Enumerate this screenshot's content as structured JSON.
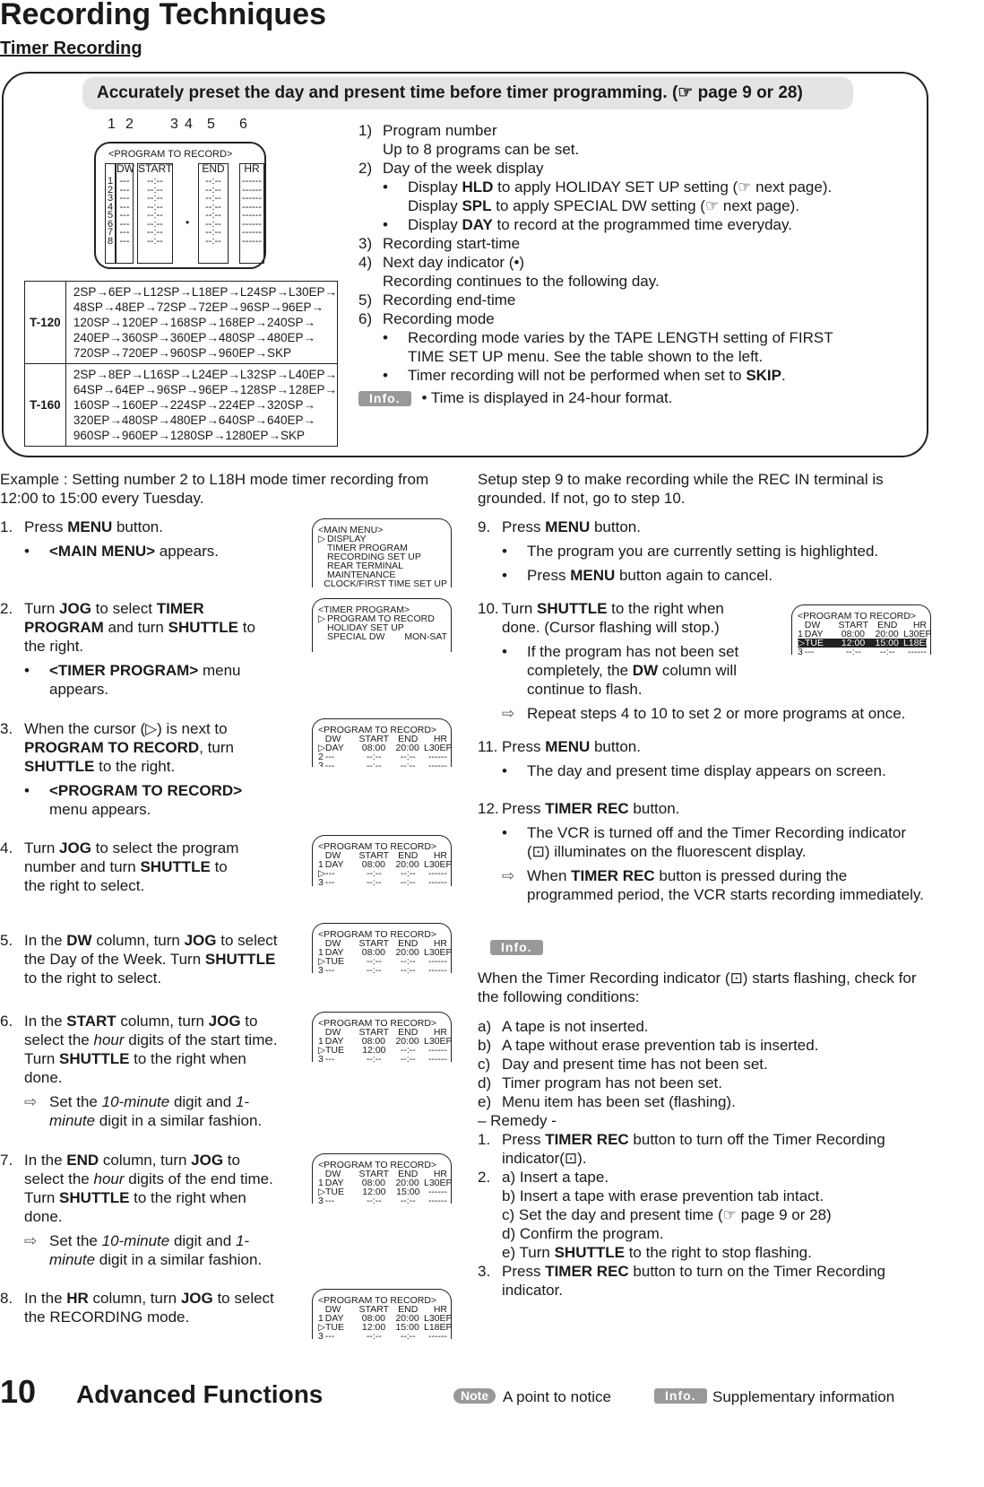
{
  "title": "Recording Techniques",
  "subtitle": "Timer Recording",
  "banner": "Accurately preset the day and present time before timer programming. (☞ page 9 or 28)",
  "diagram": {
    "callouts": [
      "1",
      "2",
      "3",
      "4",
      "5",
      "6"
    ],
    "title": "<PROGRAM TO RECORD>",
    "headers": [
      "DW",
      "START",
      "END",
      "HR"
    ],
    "numbers": [
      "1",
      "2",
      "3",
      "4",
      "5",
      "6",
      "7",
      "8"
    ],
    "dw": "---",
    "start": "--:--",
    "end": "--:--",
    "hr": "------",
    "dot": "•"
  },
  "tape_table": [
    {
      "key": "T-120",
      "lines": [
        "2SP→6EP→L12SP→L18EP→L24SP→L30EP→",
        "48SP→48EP→72SP→72EP→96SP→96EP→",
        "120SP→120EP→168SP→168EP→240SP→",
        "240EP→360SP→360EP→480SP→480EP→",
        "720SP→720EP→960SP→960EP→SKP"
      ]
    },
    {
      "key": "T-160",
      "lines": [
        "2SP→8EP→L16SP→L24EP→L32SP→L40EP→",
        "64SP→64EP→96SP→96EP→128SP→128EP→",
        "160SP→160EP→224SP→224EP→320SP→",
        "320EP→480SP→480EP→640SP→640EP→",
        "960SP→960EP→1280SP→1280EP→SKP"
      ]
    }
  ],
  "legend": [
    {
      "n": "1)",
      "t": "Program number"
    },
    {
      "n": "",
      "t": "Up to 8 programs can be set."
    },
    {
      "n": "2)",
      "t": "Day of the week display"
    },
    {
      "b": "•",
      "t": "Display **HLD** to apply HOLIDAY SET UP setting (☞ next page)."
    },
    {
      "b": "",
      "t": "Display **SPL** to apply SPECIAL DW setting (☞ next page)."
    },
    {
      "b": "•",
      "t": "Display **DAY** to record at the programmed time everyday."
    },
    {
      "n": "3)",
      "t": "Recording start-time"
    },
    {
      "n": "4)",
      "t": "Next day indicator (•)"
    },
    {
      "n": "",
      "t": "Recording continues to the following day."
    },
    {
      "n": "5)",
      "t": "Recording end-time"
    },
    {
      "n": "6)",
      "t": "Recording mode"
    },
    {
      "b": "•",
      "t": "Recording mode varies by the TAPE LENGTH setting of FIRST"
    },
    {
      "b": "",
      "t": "TIME SET UP menu.  See the table shown to the left."
    },
    {
      "b": "•",
      "t": "Timer recording will not be performed when set to **SKIP**."
    }
  ],
  "legend_info": {
    "badge": "Info.",
    "text": "•  Time is displayed in 24-hour format."
  },
  "example": "Example : Setting number 2 to L18H mode timer recording from 12:00 to 15:00 every Tuesday.",
  "left_steps": [
    {
      "n": "1.",
      "t": "Press **MENU** button.",
      "items": [
        {
          "b": "•",
          "t": "**<MAIN MENU>** appears."
        }
      ]
    },
    {
      "n": "2.",
      "t": "Turn **JOG** to select **TIMER PROGRAM** and turn **SHUTTLE** to the right.",
      "items": [
        {
          "b": "•",
          "t": "**<TIMER PROGRAM>** menu appears."
        }
      ]
    },
    {
      "n": "3.",
      "t": "When the cursor (▷) is next to **PROGRAM TO RECORD**, turn **SHUTTLE** to the right.",
      "items": [
        {
          "b": "•",
          "t": "**<PROGRAM TO RECORD>** menu appears."
        }
      ]
    },
    {
      "n": "4.",
      "t": "Turn **JOG** to select the program number and turn **SHUTTLE** to the right to select.",
      "items": []
    },
    {
      "n": "5.",
      "t": "In the **DW** column, turn **JOG** to select the Day of the Week. Turn **SHUTTLE** to the right to select.",
      "items": []
    },
    {
      "n": "6.",
      "t": "In the **START** column, turn **JOG** to select the _hour_ digits of the start time. Turn **SHUTTLE** to the right when done.",
      "items": [
        {
          "a": "⇨",
          "t": "Set the _10-minute_ digit and _1-minute_ digit in a similar fashion."
        }
      ]
    },
    {
      "n": "7.",
      "t": "In the **END** column, turn **JOG** to select the _hour_ digits of the end time. Turn **SHUTTLE** to the right when done.",
      "items": [
        {
          "a": "⇨",
          "t": "Set the _10-minute_ digit and _1-minute_ digit in a similar fashion."
        }
      ]
    },
    {
      "n": "8.",
      "t": "In the **HR** column, turn **JOG** to select the RECORDING mode.",
      "items": []
    }
  ],
  "screens": [
    {
      "title": "<MAIN MENU>",
      "items": [
        [
          "▷",
          "DISPLAY"
        ],
        [
          "",
          "TIMER PROGRAM"
        ],
        [
          "",
          "RECORDING SET UP"
        ],
        [
          "",
          "REAR TERMINAL"
        ],
        [
          "",
          "MAINTENANCE"
        ],
        [
          "",
          "CLOCK/FIRST TIME SET UP"
        ]
      ]
    },
    {
      "title": "<TIMER PROGRAM>",
      "items": [
        [
          "▷",
          "PROGRAM TO RECORD"
        ],
        [
          "",
          "HOLIDAY SET UP"
        ],
        [
          "",
          "SPECIAL DW",
          "MON-SAT"
        ]
      ]
    },
    {
      "title": "<PROGRAM TO RECORD>",
      "header": [
        "DW",
        "START",
        "END",
        "HR"
      ],
      "rows": [
        [
          "▷",
          "DAY",
          "08:00",
          "20:00",
          "L30EP"
        ],
        [
          "2",
          "---",
          "--:--",
          "--:--",
          "------"
        ],
        [
          "3",
          "---",
          "--:--",
          "--:--",
          "------"
        ]
      ]
    },
    {
      "title": "<PROGRAM TO RECORD>",
      "header": [
        "DW",
        "START",
        "END",
        "HR"
      ],
      "rows": [
        [
          "1",
          "DAY",
          "08:00",
          "20:00",
          "L30EP"
        ],
        [
          "▷",
          "---",
          "--:--",
          "--:--",
          "------"
        ],
        [
          "3",
          "---",
          "--:--",
          "--:--",
          "------"
        ]
      ]
    },
    {
      "title": "<PROGRAM TO RECORD>",
      "header": [
        "DW",
        "START",
        "END",
        "HR"
      ],
      "rows": [
        [
          "1",
          "DAY",
          "08:00",
          "20:00",
          "L30EP"
        ],
        [
          "▷",
          "TUE",
          "--:--",
          "--:--",
          "------"
        ],
        [
          "3",
          "---",
          "--:--",
          "--:--",
          "------"
        ]
      ]
    },
    {
      "title": "<PROGRAM TO RECORD>",
      "header": [
        "DW",
        "START",
        "END",
        "HR"
      ],
      "rows": [
        [
          "1",
          "DAY",
          "08:00",
          "20:00",
          "L30EP"
        ],
        [
          "▷",
          "TUE",
          "12:00",
          "--:--",
          "------"
        ],
        [
          "3",
          "---",
          "--:--",
          "--:--",
          "------"
        ]
      ]
    },
    {
      "title": "<PROGRAM TO RECORD>",
      "header": [
        "DW",
        "START",
        "END",
        "HR"
      ],
      "rows": [
        [
          "1",
          "DAY",
          "08:00",
          "20:00",
          "L30EP"
        ],
        [
          "▷",
          "TUE",
          "12:00",
          "15:00",
          "------"
        ],
        [
          "3",
          "---",
          "--:--",
          "--:--",
          "------"
        ]
      ]
    },
    {
      "title": "<PROGRAM TO RECORD>",
      "header": [
        "DW",
        "START",
        "END",
        "HR"
      ],
      "rows": [
        [
          "1",
          "DAY",
          "08:00",
          "20:00",
          "L30EP"
        ],
        [
          "▷",
          "TUE",
          "12:00",
          "15:00",
          "L18EP"
        ],
        [
          "3",
          "---",
          "--:--",
          "--:--",
          "------"
        ]
      ]
    },
    {
      "title": "<PROGRAM TO RECORD>",
      "header": [
        "DW",
        "START",
        "END",
        "HR"
      ],
      "rows": [
        [
          "1",
          "DAY",
          "08:00",
          "20:00",
          "L30EP"
        ],
        [
          "▷",
          "TUE",
          "12:00",
          "15:00",
          "L18EP"
        ],
        [
          "3",
          "---",
          "--:--",
          "--:--",
          "------"
        ]
      ],
      "highlight": 1
    }
  ],
  "setup_note": "Setup step 9 to make recording while the REC IN terminal is grounded.  If not, go to step 10.",
  "right_steps": [
    {
      "n": "9.",
      "t": "Press **MENU** button.",
      "items": [
        {
          "b": "•",
          "t": "The program you are currently setting is highlighted."
        },
        {
          "b": "•",
          "t": "Press **MENU** button again to cancel."
        }
      ]
    },
    {
      "n": "10.",
      "t": "Turn **SHUTTLE** to the right when done. (Cursor flashing will stop.)",
      "items": [
        {
          "b": "•",
          "t": "If the program has not been set completely, the **DW** column will continue to flash."
        },
        {
          "a": "⇨",
          "t": "Repeat steps 4 to 10 to set 2 or more programs at once."
        }
      ]
    },
    {
      "n": "11.",
      "t": "Press **MENU** button.",
      "items": [
        {
          "b": "•",
          "t": "The day and present time display appears on screen."
        }
      ]
    },
    {
      "n": "12.",
      "t": "Press **TIMER REC** button.",
      "items": [
        {
          "b": "•",
          "t": "The VCR is turned off and the Timer Recording indicator (⊡) illuminates on the fluorescent display."
        },
        {
          "a": "⇨",
          "t": "When **TIMER REC** button is pressed during the programmed period, the VCR starts recording immediately."
        }
      ]
    }
  ],
  "info_section": {
    "badge": "Info.",
    "intro": "When the Timer Recording indicator (⊡) starts flashing, check for the following conditions:",
    "conditions": [
      [
        "a)",
        "A tape is not inserted."
      ],
      [
        "b)",
        "A tape without erase prevention tab is inserted."
      ],
      [
        "c)",
        "Day and present time has not been set."
      ],
      [
        "d)",
        "Timer program has not been set."
      ],
      [
        "e)",
        "Menu item has been set (flashing)."
      ]
    ],
    "remedy_label": "– Remedy -",
    "remedies": [
      {
        "n": "1.",
        "t": "Press **TIMER REC** button to turn off the Timer Recording indicator(⊡)."
      },
      {
        "n": "2.",
        "t": "a)   Insert a tape."
      },
      {
        "n": "",
        "t": "b)   Insert a tape with erase prevention tab intact."
      },
      {
        "n": "",
        "t": "c)   Set the day and present time (☞ page 9 or 28)"
      },
      {
        "n": "",
        "t": "d)   Confirm the program."
      },
      {
        "n": "",
        "t": "e)   Turn **SHUTTLE** to the right to stop flashing."
      },
      {
        "n": "3.",
        "t": "Press **TIMER REC** button to turn on the Timer Recording indicator."
      }
    ]
  },
  "footer": {
    "page": "10",
    "section": "Advanced Functions",
    "note_badge": "Note",
    "note_text": "A point to notice",
    "info_badge": "Info.",
    "info_text": "Supplementary information"
  }
}
